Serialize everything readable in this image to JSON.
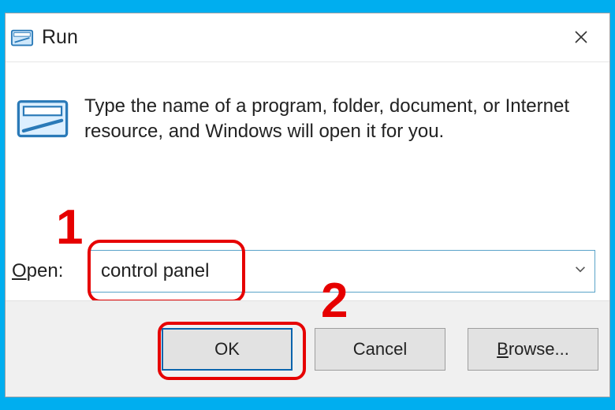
{
  "window": {
    "title": "Run",
    "close_name": "close"
  },
  "body": {
    "description": "Type the name of a program, folder, document, or Internet resource, and Windows will open it for you.",
    "open_label_prefix": "O",
    "open_label_rest": "pen:",
    "input_value": "control panel"
  },
  "buttons": {
    "ok": "OK",
    "cancel": "Cancel",
    "browse_prefix": "B",
    "browse_rest": "rowse..."
  },
  "annotations": {
    "step1": "1",
    "step2": "2"
  },
  "icons": {
    "app": "run-icon",
    "close": "close-icon",
    "chevron": "chevron-down-icon"
  }
}
